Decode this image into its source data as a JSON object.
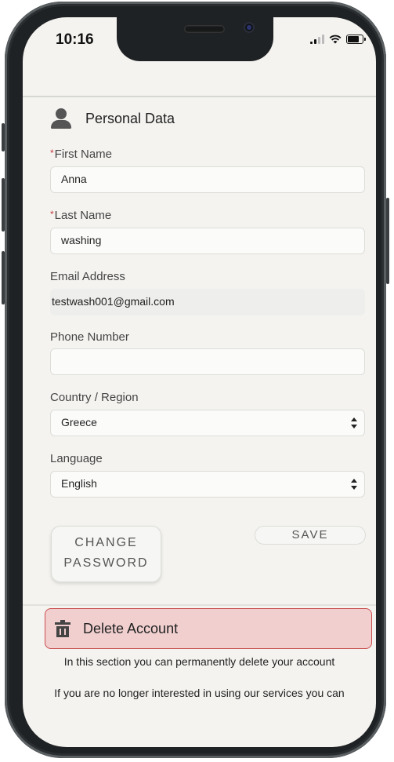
{
  "status_bar": {
    "time": "10:16",
    "icons": [
      "signal-icon",
      "wifi-icon",
      "battery-icon"
    ]
  },
  "personal_data": {
    "section_title": "Personal Data",
    "first_name": {
      "label": "First Name",
      "required": "*",
      "value": "Anna"
    },
    "last_name": {
      "label": "Last Name",
      "required": "*",
      "value": "washing"
    },
    "email": {
      "label": "Email Address",
      "value": "testwash001@gmail.com"
    },
    "phone": {
      "label": "Phone Number",
      "value": ""
    },
    "country": {
      "label": "Country / Region",
      "value": "Greece"
    },
    "language": {
      "label": "Language",
      "value": "English"
    },
    "change_password_line1": "CHANGE",
    "change_password_line2": "PASSWORD",
    "save_label": "SAVE"
  },
  "delete_account": {
    "title": "Delete Account",
    "info_line1": "In this section you can permanently delete your account",
    "info_line2": "If you are no longer interested in using our services you can"
  },
  "colors": {
    "required": "#c43b3b",
    "danger_bg": "#f1cfcf",
    "danger_border": "#c94c4c",
    "screen_bg": "#f4f3f0"
  }
}
